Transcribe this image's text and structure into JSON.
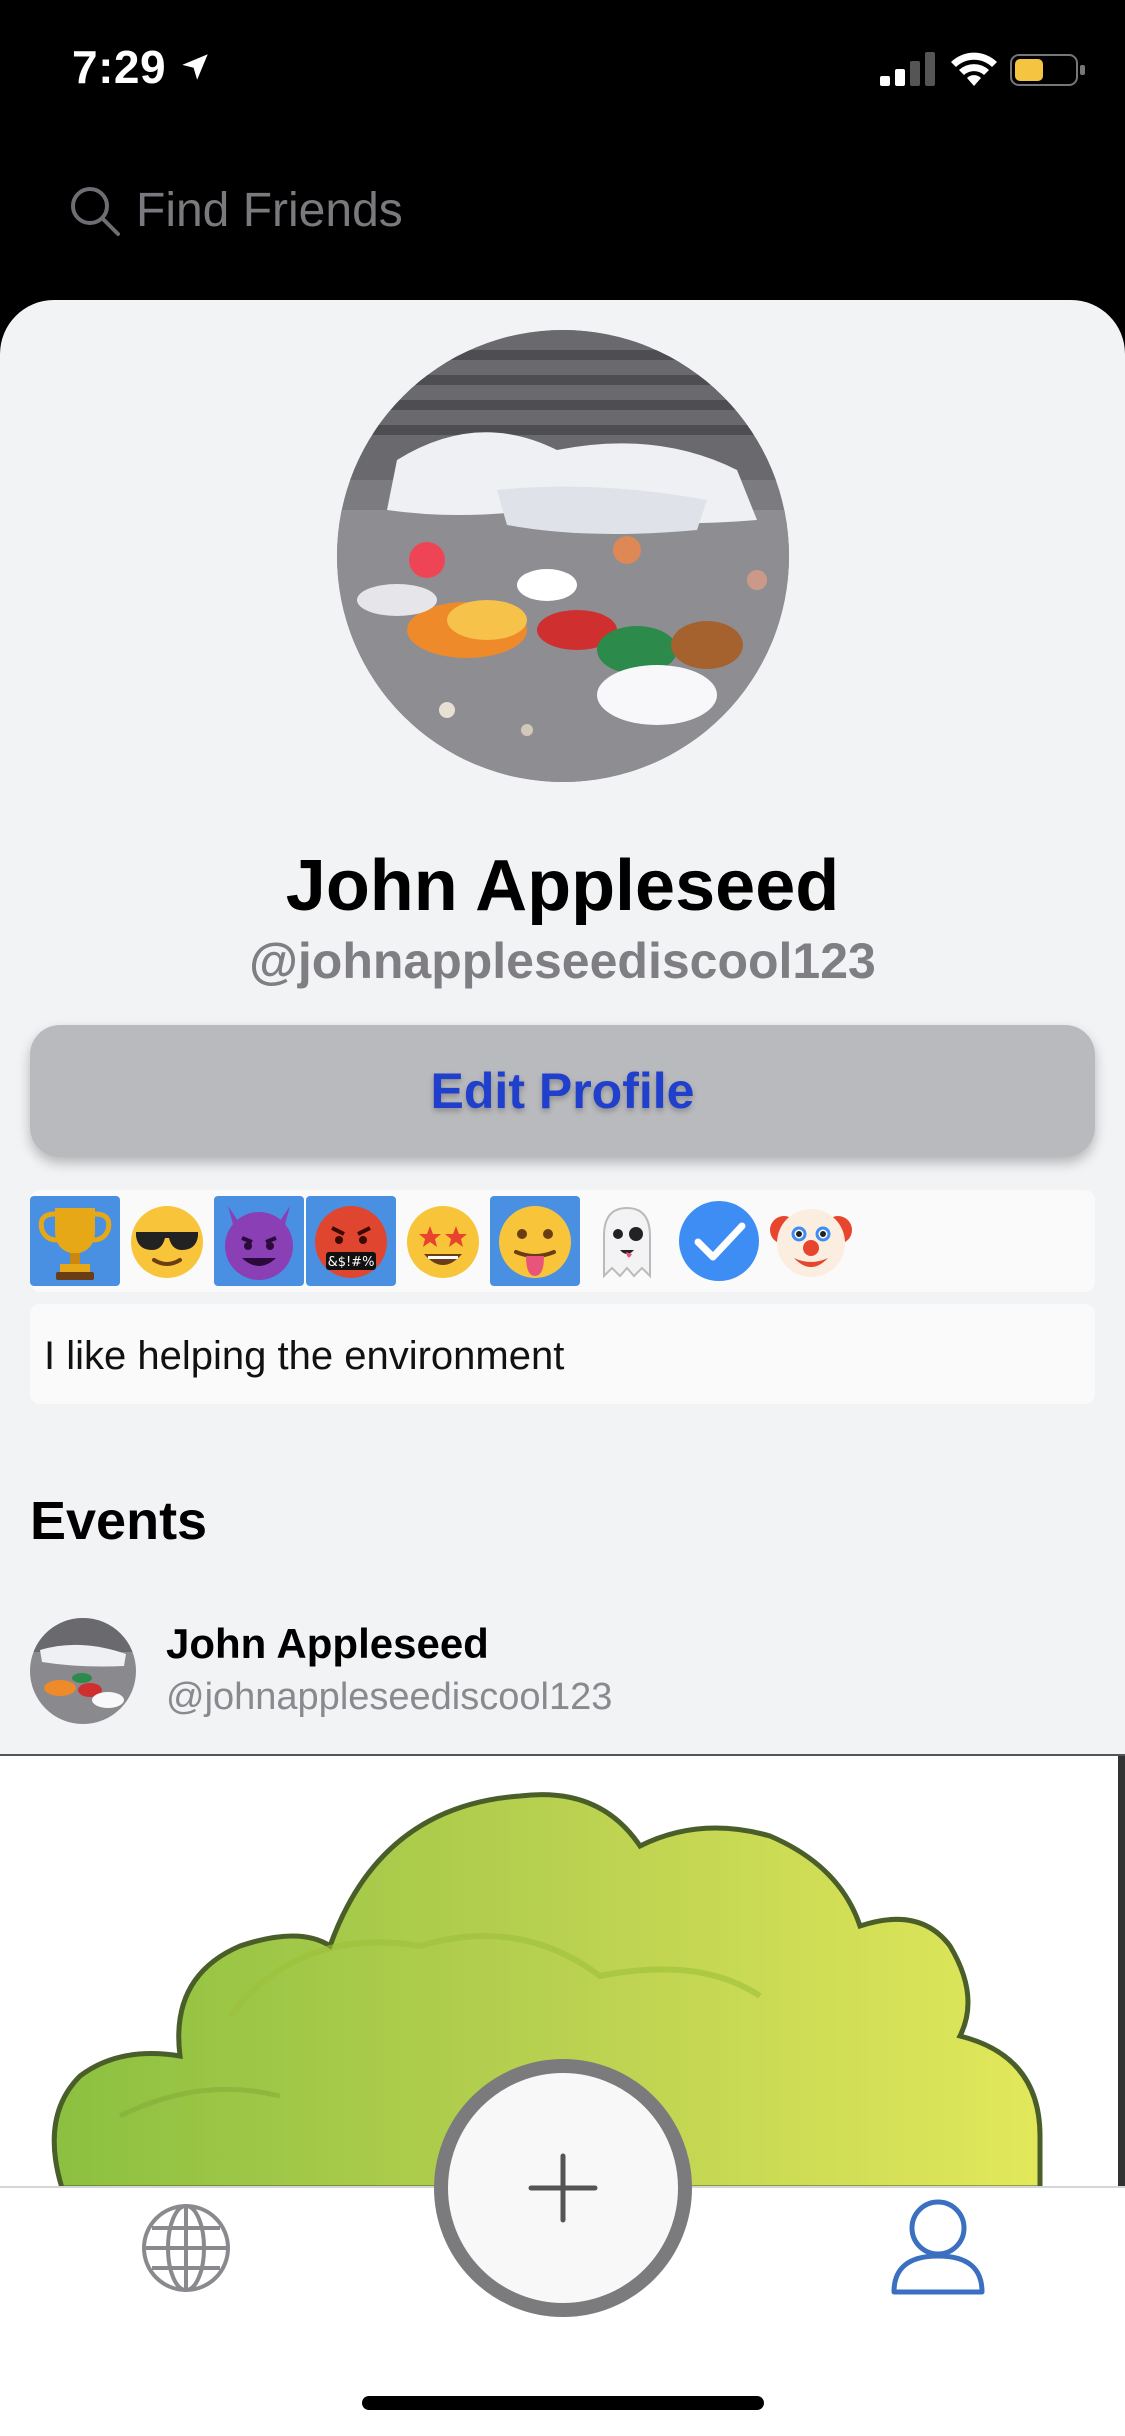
{
  "status_bar": {
    "time": "7:29",
    "location_icon": "location-arrow-icon",
    "signal_icon": "cellular-signal-icon",
    "wifi_icon": "wifi-icon",
    "battery_icon": "battery-icon",
    "battery_color": "#f5c542"
  },
  "search": {
    "placeholder": "Find Friends",
    "value": "",
    "icon": "magnifying-glass-icon"
  },
  "profile": {
    "name": "John Appleseed",
    "handle": "@johnappleseediscool123",
    "edit_label": "Edit Profile",
    "bio": "I like helping the environment",
    "badges": [
      {
        "icon": "trophy-icon",
        "highlighted": true
      },
      {
        "icon": "sunglasses-face-icon",
        "highlighted": false
      },
      {
        "icon": "smiling-devil-icon",
        "highlighted": true
      },
      {
        "icon": "cursing-face-icon",
        "highlighted": true
      },
      {
        "icon": "star-struck-face-icon",
        "highlighted": false
      },
      {
        "icon": "tongue-face-icon",
        "highlighted": true
      },
      {
        "icon": "ghost-icon",
        "highlighted": false
      },
      {
        "icon": "checkmark-icon",
        "highlighted": false
      },
      {
        "icon": "clown-face-icon",
        "highlighted": false
      }
    ],
    "cursing_symbols": "&$!#%"
  },
  "events": {
    "title": "Events",
    "items": [
      {
        "name": "John Appleseed",
        "handle": "@johnappleseediscool123"
      }
    ]
  },
  "tab_bar": {
    "items": [
      "globe-icon",
      "add-icon",
      "profile-icon"
    ],
    "active": "profile-icon",
    "active_color": "#3b6fc0"
  },
  "colors": {
    "accent": "#1f3fcc",
    "badge_highlight": "#4a90e2",
    "bush_green": "#9cc63f"
  }
}
